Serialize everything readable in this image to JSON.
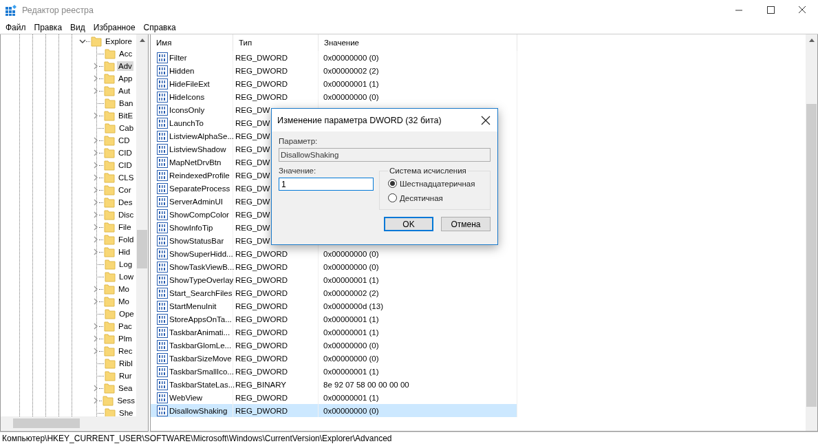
{
  "window": {
    "title": "Редактор реестра"
  },
  "menu": [
    "Файл",
    "Правка",
    "Вид",
    "Избранное",
    "Справка"
  ],
  "tree": {
    "label": "Explore",
    "expanded": true,
    "selected": false,
    "children": [
      {
        "label": "Acc",
        "expandable": false,
        "selected": false
      },
      {
        "label": "Adv",
        "expandable": true,
        "selected": true
      },
      {
        "label": "App",
        "expandable": true,
        "selected": false
      },
      {
        "label": "Aut",
        "expandable": true,
        "selected": false
      },
      {
        "label": "Ban",
        "expandable": false,
        "selected": false
      },
      {
        "label": "BitE",
        "expandable": true,
        "selected": false
      },
      {
        "label": "Cab",
        "expandable": false,
        "selected": false
      },
      {
        "label": "CD",
        "expandable": true,
        "selected": false
      },
      {
        "label": "CID",
        "expandable": true,
        "selected": false
      },
      {
        "label": "CID",
        "expandable": true,
        "selected": false
      },
      {
        "label": "CLS",
        "expandable": true,
        "selected": false
      },
      {
        "label": "Cor",
        "expandable": true,
        "selected": false
      },
      {
        "label": "Des",
        "expandable": true,
        "selected": false
      },
      {
        "label": "Disc",
        "expandable": true,
        "selected": false
      },
      {
        "label": "File",
        "expandable": true,
        "selected": false
      },
      {
        "label": "Fold",
        "expandable": true,
        "selected": false
      },
      {
        "label": "Hid",
        "expandable": true,
        "selected": false
      },
      {
        "label": "Log",
        "expandable": false,
        "selected": false
      },
      {
        "label": "Low",
        "expandable": false,
        "selected": false
      },
      {
        "label": "Mo",
        "expandable": true,
        "selected": false
      },
      {
        "label": "Mo",
        "expandable": true,
        "selected": false
      },
      {
        "label": "Ope",
        "expandable": false,
        "selected": false
      },
      {
        "label": "Pac",
        "expandable": true,
        "selected": false
      },
      {
        "label": "Plm",
        "expandable": true,
        "selected": false
      },
      {
        "label": "Rec",
        "expandable": true,
        "selected": false
      },
      {
        "label": "Ribl",
        "expandable": false,
        "selected": false
      },
      {
        "label": "Rur",
        "expandable": false,
        "selected": false
      },
      {
        "label": "Sea",
        "expandable": true,
        "selected": false
      },
      {
        "label": "Sess",
        "expandable": true,
        "selected": false
      },
      {
        "label": "She",
        "expandable": false,
        "selected": false
      }
    ]
  },
  "table": {
    "columns": [
      "Имя",
      "Тип",
      "Значение"
    ],
    "rows": [
      {
        "name": "Filter",
        "type": "REG_DWORD",
        "value": "0x00000000 (0)",
        "selected": false
      },
      {
        "name": "Hidden",
        "type": "REG_DWORD",
        "value": "0x00000002 (2)",
        "selected": false
      },
      {
        "name": "HideFileExt",
        "type": "REG_DWORD",
        "value": "0x00000001 (1)",
        "selected": false
      },
      {
        "name": "HideIcons",
        "type": "REG_DWORD",
        "value": "0x00000000 (0)",
        "selected": false
      },
      {
        "name": "IconsOnly",
        "type": "REG_DW",
        "selected": false
      },
      {
        "name": "LaunchTo",
        "type": "REG_DW",
        "selected": false
      },
      {
        "name": "ListviewAlphaSe...",
        "type": "REG_DW",
        "selected": false
      },
      {
        "name": "ListviewShadow",
        "type": "REG_DW",
        "selected": false
      },
      {
        "name": "MapNetDrvBtn",
        "type": "REG_DW",
        "selected": false
      },
      {
        "name": "ReindexedProfile",
        "type": "REG_DW",
        "selected": false
      },
      {
        "name": "SeparateProcess",
        "type": "REG_DW",
        "selected": false
      },
      {
        "name": "ServerAdminUI",
        "type": "REG_DW",
        "selected": false
      },
      {
        "name": "ShowCompColor",
        "type": "REG_DW",
        "selected": false
      },
      {
        "name": "ShowInfoTip",
        "type": "REG_DW",
        "selected": false
      },
      {
        "name": "ShowStatusBar",
        "type": "REG_DW",
        "selected": false
      },
      {
        "name": "ShowSuperHidd...",
        "type": "REG_DWORD",
        "value": "0x00000000 (0)",
        "selected": false
      },
      {
        "name": "ShowTaskViewB...",
        "type": "REG_DWORD",
        "value": "0x00000000 (0)",
        "selected": false
      },
      {
        "name": "ShowTypeOverlay",
        "type": "REG_DWORD",
        "value": "0x00000001 (1)",
        "selected": false
      },
      {
        "name": "Start_SearchFiles",
        "type": "REG_DWORD",
        "value": "0x00000002 (2)",
        "selected": false
      },
      {
        "name": "StartMenuInit",
        "type": "REG_DWORD",
        "value": "0x0000000d (13)",
        "selected": false
      },
      {
        "name": "StoreAppsOnTa...",
        "type": "REG_DWORD",
        "value": "0x00000001 (1)",
        "selected": false
      },
      {
        "name": "TaskbarAnimati...",
        "type": "REG_DWORD",
        "value": "0x00000001 (1)",
        "selected": false
      },
      {
        "name": "TaskbarGlomLe...",
        "type": "REG_DWORD",
        "value": "0x00000000 (0)",
        "selected": false
      },
      {
        "name": "TaskbarSizeMove",
        "type": "REG_DWORD",
        "value": "0x00000000 (0)",
        "selected": false
      },
      {
        "name": "TaskbarSmallIco...",
        "type": "REG_DWORD",
        "value": "0x00000001 (1)",
        "selected": false
      },
      {
        "name": "TaskbarStateLas...",
        "type": "REG_BINARY",
        "value": "8e 92 07 58 00 00 00 00",
        "selected": false
      },
      {
        "name": "WebView",
        "type": "REG_DWORD",
        "value": "0x00000001 (1)",
        "selected": false
      },
      {
        "name": "DisallowShaking",
        "type": "REG_DWORD",
        "value": "0x00000000 (0)",
        "selected": true
      }
    ]
  },
  "status_bar": "Компьютер\\HKEY_CURRENT_USER\\SOFTWARE\\Microsoft\\Windows\\CurrentVersion\\Explorer\\Advanced",
  "dialog": {
    "title": "Изменение параметра DWORD (32 бита)",
    "param_label": "Параметр:",
    "param_value": "DisallowShaking",
    "value_label": "Значение:",
    "value": "1",
    "base_label": "Система исчисления",
    "base_options": [
      {
        "label": "Шестнадцатеричная",
        "selected": true
      },
      {
        "label": "Десятичная",
        "selected": false
      }
    ],
    "buttons": [
      {
        "label": "OK",
        "default": true
      },
      {
        "label": "Отмена",
        "default": false
      }
    ]
  }
}
